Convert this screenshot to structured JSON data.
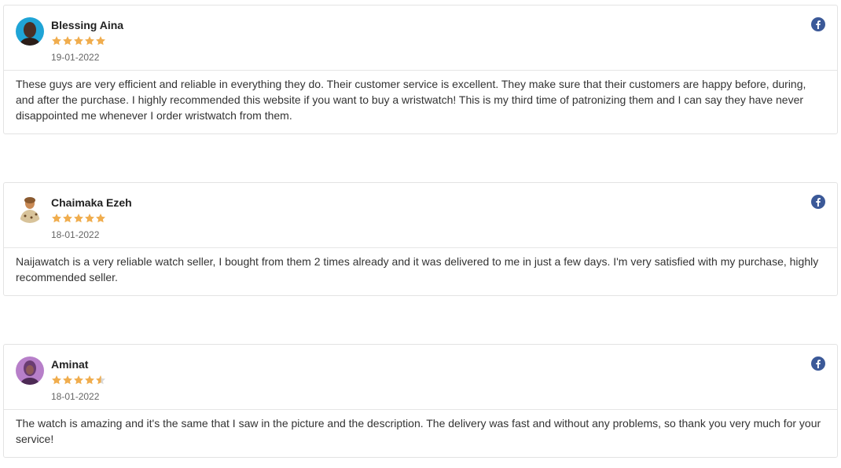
{
  "reviews": [
    {
      "name": "Blessing Aina",
      "date": "19-01-2022",
      "rating": 5,
      "text": "These guys are very efficient and reliable in everything they do. Their customer service is excellent. They make sure that their customers are happy before, during, and after the purchase. I highly recommended this website if you want to buy a wristwatch! This is my third time of patronizing them and I can say they have never disappointed me whenever I order wristwatch from them.",
      "source_icon": "facebook-icon"
    },
    {
      "name": "Chaimaka Ezeh",
      "date": "18-01-2022",
      "rating": 5,
      "text": "Naijawatch is a very reliable watch seller, I bought from them 2 times already and it was delivered to me in just a few days. I'm very satisfied with my purchase, highly recommended seller.",
      "source_icon": "facebook-icon"
    },
    {
      "name": "Aminat",
      "date": "18-01-2022",
      "rating": 4.5,
      "text": "The watch is amazing and it's the same that I saw in the picture and the description. The delivery was fast and without any problems, so thank you very much for your service!",
      "source_icon": "facebook-icon"
    }
  ],
  "colors": {
    "star": "#f0ad4e",
    "star_empty": "#d9d9d9",
    "facebook": "#3b5998"
  }
}
